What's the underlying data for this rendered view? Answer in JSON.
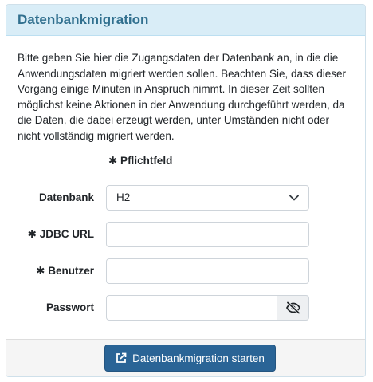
{
  "panel": {
    "title": "Datenbankmigration",
    "intro": "Bitte geben Sie hier die Zugangsdaten der Datenbank an, in die die Anwendungsdaten migriert werden sollen. Beachten Sie, dass dieser Vorgang einige Minuten in Anspruch nimmt. In dieser Zeit sollten möglichst keine Aktionen in der Anwendung durchgeführt werden, da die Daten, die dabei erzeugt werden, unter Umständen nicht oder nicht vollständig migriert werden."
  },
  "form": {
    "required_hint": "✱ Pflichtfeld",
    "database": {
      "label": "Datenbank",
      "value": "H2"
    },
    "jdbc_url": {
      "label": "✱ JDBC URL",
      "value": ""
    },
    "user": {
      "label": "✱ Benutzer",
      "value": ""
    },
    "password": {
      "label": "Passwort",
      "value": ""
    }
  },
  "footer": {
    "submit_label": "Datenbankmigration starten"
  },
  "icons": {
    "chevron": "chevron-down-icon",
    "eye": "eye-slash-icon",
    "external": "external-link-icon"
  },
  "colors": {
    "heading_bg": "#d9edf7",
    "heading_text": "#31708f",
    "button_bg": "#2a6496"
  }
}
